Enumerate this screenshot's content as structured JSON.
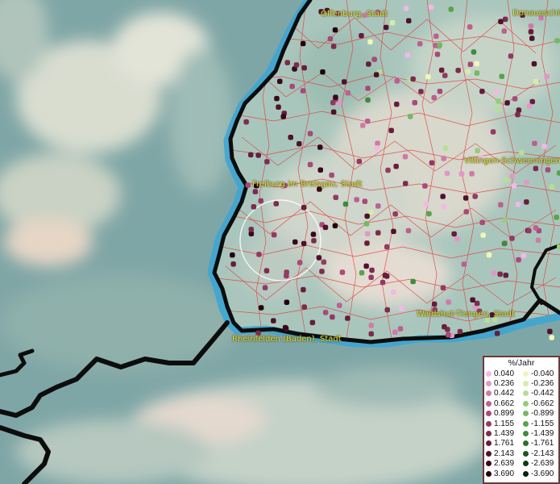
{
  "map": {
    "city_labels": [
      {
        "id": "offenburg",
        "text": "Offenburg, Stadt"
      },
      {
        "id": "donaueschingen",
        "text": "Donaueschingen"
      },
      {
        "id": "villingen",
        "text": "Villingen-Schwenningen,"
      },
      {
        "id": "freiburg",
        "text": "Freiburg im Breisgau, Stadt"
      },
      {
        "id": "waldshut",
        "text": "Waldshut-Tiengen, Stadt"
      },
      {
        "id": "rheinfelden",
        "text": "Rheinfelden (Baden), Stadt"
      }
    ],
    "colors": {
      "border": "#0d0d0d",
      "river": "#3aa6d6",
      "municipal_lines": "#e23b3b",
      "highlight_circle": "#ffffff",
      "label_text": "#e8e23a"
    }
  },
  "legend": {
    "title": "%/Jahr",
    "positive": [
      {
        "label": "0.040",
        "color": "#f2b8e6"
      },
      {
        "label": "0.236",
        "color": "#e397c7"
      },
      {
        "label": "0.442",
        "color": "#d07aa8"
      },
      {
        "label": "0.662",
        "color": "#bc6090"
      },
      {
        "label": "0.899",
        "color": "#a84a78"
      },
      {
        "label": "1.155",
        "color": "#933a62"
      },
      {
        "label": "1.439",
        "color": "#7d2b4d"
      },
      {
        "label": "1.761",
        "color": "#661e3a"
      },
      {
        "label": "2.143",
        "color": "#4f122a"
      },
      {
        "label": "2.639",
        "color": "#38081b"
      },
      {
        "label": "3.690",
        "color": "#22020e"
      }
    ],
    "negative": [
      {
        "label": "-0.040",
        "color": "#eef7b8"
      },
      {
        "label": "-0.236",
        "color": "#d4eeaa"
      },
      {
        "label": "-0.442",
        "color": "#b6df94"
      },
      {
        "label": "-0.662",
        "color": "#95cd7c"
      },
      {
        "label": "-0.899",
        "color": "#74b964"
      },
      {
        "label": "-1.155",
        "color": "#57a44d"
      },
      {
        "label": "-1.439",
        "color": "#3e8c3b"
      },
      {
        "label": "-1.761",
        "color": "#2a712b"
      },
      {
        "label": "-2.143",
        "color": "#1b561e"
      },
      {
        "label": "-2.639",
        "color": "#0f3b12"
      },
      {
        "label": "-3.690",
        "color": "#062308"
      }
    ]
  }
}
